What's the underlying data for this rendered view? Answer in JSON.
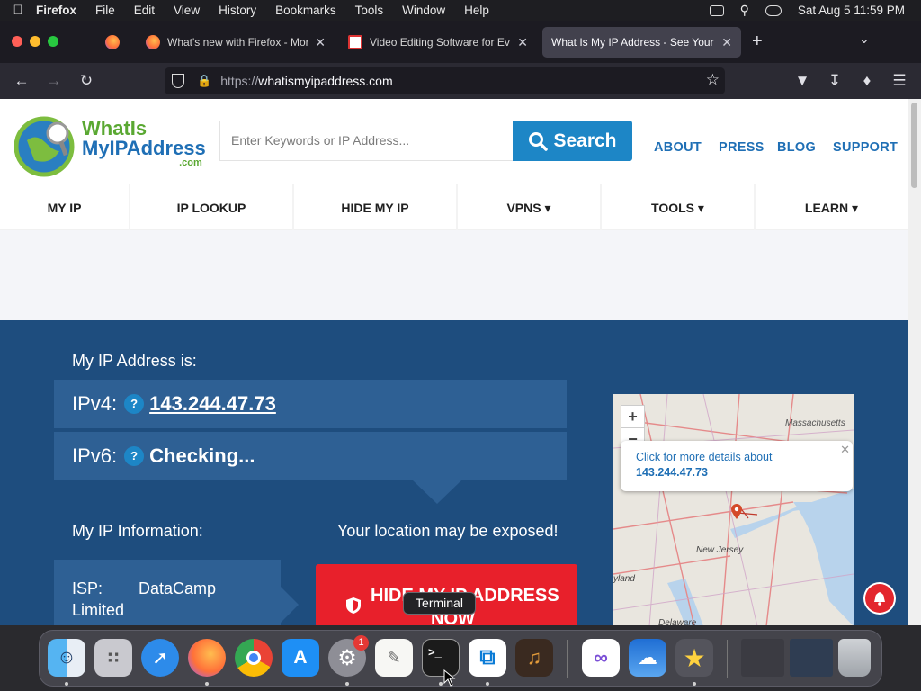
{
  "menubar": {
    "app_name": "Firefox",
    "items": [
      "File",
      "Edit",
      "View",
      "History",
      "Bookmarks",
      "Tools",
      "Window",
      "Help"
    ],
    "clock": "Sat Aug 5  11:59 PM"
  },
  "tabs": [
    {
      "title": "What's new with Firefox - More"
    },
    {
      "title": "Video Editing Software for Every"
    },
    {
      "title": "What Is My IP Address - See Your Pu"
    }
  ],
  "url": {
    "scheme": "https://",
    "host": "whatismyipaddress.com"
  },
  "site": {
    "logo_line1": "WhatIs",
    "logo_line2": "MyIPAddress",
    "logo_suffix": ".com",
    "search_placeholder": "Enter Keywords or IP Address...",
    "search_button": "Search",
    "top_links": [
      "ABOUT",
      "PRESS",
      "BLOG",
      "SUPPORT"
    ],
    "nav": [
      "MY IP",
      "IP LOOKUP",
      "HIDE MY IP",
      "VPNS ▾",
      "TOOLS ▾",
      "LEARN ▾"
    ]
  },
  "hero": {
    "heading": "My IP Address is:",
    "ipv4_label": "IPv4:",
    "ipv4_value": "143.244.47.73",
    "ipv6_label": "IPv6:",
    "ipv6_value": "Checking...",
    "qmark": "?",
    "info_heading": "My IP Information:",
    "exposed": "Your location may be exposed!",
    "isp_label": "ISP:",
    "isp_value": "DataCamp",
    "isp_value2": "Limited",
    "hide_btn_line1": "HIDE MY IP ADDRESS",
    "hide_btn_line2": "NOW"
  },
  "map": {
    "zoom_in": "+",
    "zoom_out": "−",
    "popup_line1": "Click for more details about",
    "popup_line2": "143.244.47.73",
    "label_massachusetts": "Massachusetts",
    "label_new_jersey": "New Jersey",
    "label_maryland": "yland",
    "label_delaware": "Delaware"
  },
  "dock": {
    "tooltip": "Terminal",
    "settings_badge": "1"
  },
  "colors": {
    "hero_bg": "#1e4d7e",
    "panel_bg": "#2e6094",
    "accent_blue": "#1d86c6",
    "hide_red": "#e8202b",
    "link_blue": "#1f6fb5"
  }
}
